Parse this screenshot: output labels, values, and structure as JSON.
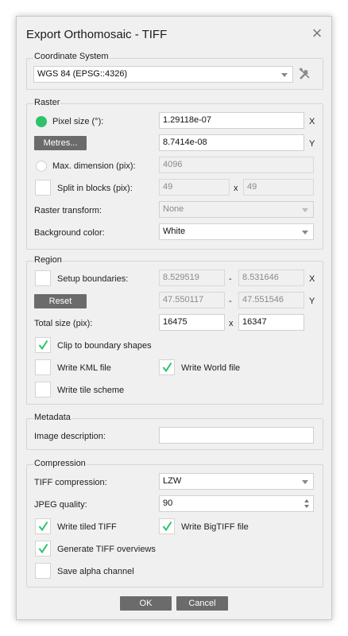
{
  "dialog": {
    "title": "Export Orthomosaic - TIFF",
    "close_glyph": "×"
  },
  "coordinate_system": {
    "group_title": "Coordinate System",
    "value": "WGS 84 (EPSG::4326)"
  },
  "raster": {
    "group_title": "Raster",
    "pixel_size_label": "Pixel size (°):",
    "pixel_size_x": "1.29118e-07",
    "pixel_size_y": "8.7414e-08",
    "metres_button": "Metres...",
    "axis_x": "X",
    "axis_y": "Y",
    "max_dimension_label": "Max. dimension (pix):",
    "max_dimension_value": "4096",
    "split_blocks_label": "Split in blocks (pix):",
    "split_w": "49",
    "split_h": "49",
    "split_sep": "x",
    "transform_label": "Raster transform:",
    "transform_value": "None",
    "background_label": "Background color:",
    "background_value": "White"
  },
  "region": {
    "group_title": "Region",
    "setup_boundaries_label": "Setup boundaries:",
    "x_min": "8.529519",
    "x_max": "8.531646",
    "y_min": "47.550117",
    "y_max": "47.551546",
    "dash": "-",
    "axis_x": "X",
    "axis_y": "Y",
    "reset_button": "Reset",
    "total_size_label": "Total size (pix):",
    "total_w": "16475",
    "total_h": "16347",
    "total_sep": "x",
    "clip_label": "Clip to boundary shapes",
    "kml_label": "Write KML file",
    "world_label": "Write World file",
    "tile_scheme_label": "Write tile scheme"
  },
  "metadata": {
    "group_title": "Metadata",
    "description_label": "Image description:",
    "description_value": ""
  },
  "compression": {
    "group_title": "Compression",
    "tiff_compression_label": "TIFF compression:",
    "tiff_compression_value": "LZW",
    "jpeg_quality_label": "JPEG quality:",
    "jpeg_quality_value": "90",
    "tiled_label": "Write tiled TIFF",
    "bigtiff_label": "Write BigTIFF file",
    "overviews_label": "Generate TIFF overviews",
    "alpha_label": "Save alpha channel"
  },
  "buttons": {
    "ok": "OK",
    "cancel": "Cancel"
  },
  "colors": {
    "check_green": "#2ec26a",
    "button_gray": "#6b6b6b"
  }
}
